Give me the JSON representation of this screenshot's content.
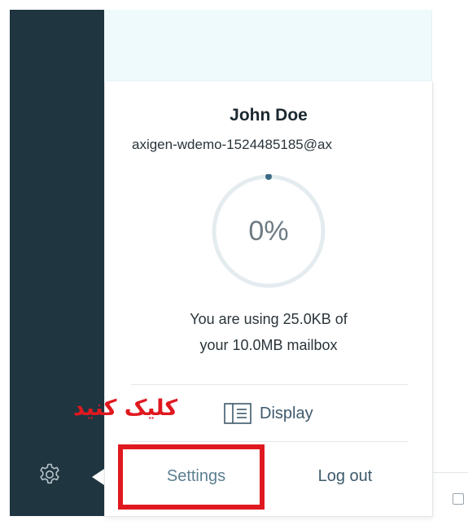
{
  "user": {
    "name": "John Doe",
    "email": "axigen-wdemo-1524485185@ax"
  },
  "storage": {
    "percent_label": "0%",
    "percent_value": 0,
    "usage_line1": "You are using 25.0KB of",
    "usage_line2": "your 10.0MB mailbox"
  },
  "menu": {
    "display_label": "Display",
    "display_icon": "list-icon",
    "settings_label": "Settings",
    "logout_label": "Log out"
  },
  "sidebar": {
    "gear_icon": "gear-icon"
  },
  "annotation": {
    "text": "کلیک کنید",
    "color": "#e0181f"
  },
  "colors": {
    "sidebar_bg": "#1f3540",
    "topbar_bg": "#eefafc",
    "ring_track": "#e4ecef",
    "ring_dot": "#3c6a86"
  }
}
